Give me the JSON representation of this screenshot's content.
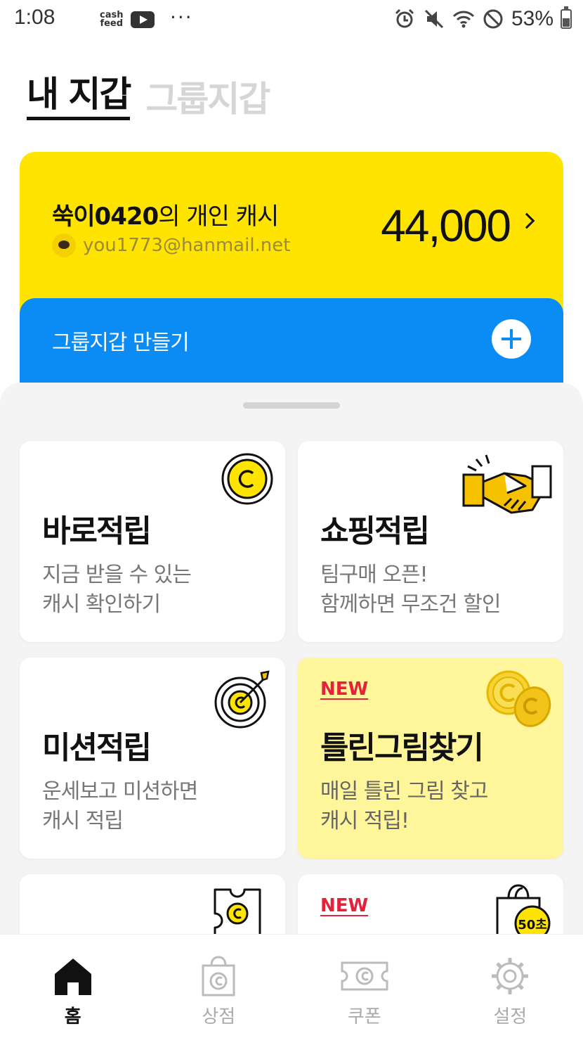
{
  "status_bar": {
    "time": "1:08",
    "cashfeed_line1": "cash",
    "cashfeed_line2": "feed",
    "more": "···",
    "battery": "53%",
    "icons": [
      "alarm-icon",
      "mute-icon",
      "wifi-icon",
      "do-not-disturb-icon",
      "battery-icon"
    ]
  },
  "tabs": [
    {
      "label": "내 지갑",
      "active": true
    },
    {
      "label": "그룹지갑",
      "active": false
    }
  ],
  "cash_card": {
    "owner_name": "쑥이0420",
    "owner_suffix": "의 개인 캐시",
    "email": "you1773@hanmail.net",
    "amount": "44,000",
    "color": "#ffe400"
  },
  "group_card": {
    "label": "그룹지갑 만들기",
    "color": "#0a8cf4"
  },
  "cards": [
    {
      "title": "바로적립",
      "desc_line1": "지금 받을 수 있는",
      "desc_line2": "캐시 확인하기",
      "icon": "coin-icon"
    },
    {
      "title": "쇼핑적립",
      "desc_line1": "팀구매 오픈!",
      "desc_line2": "함께하면 무조건 할인",
      "icon": "handshake-icon"
    },
    {
      "title": "미션적립",
      "desc_line1": "운세보고 미션하면",
      "desc_line2": "캐시 적립",
      "icon": "target-icon"
    },
    {
      "badge": "NEW",
      "title": "틀린그림찾기",
      "desc_line1": "매일 틀린 그림 찾고",
      "desc_line2": "캐시 적립!",
      "icon": "coins-icon"
    },
    {
      "title": "",
      "icon": "puzzle-coin-icon"
    },
    {
      "badge": "NEW",
      "title": "",
      "icon": "shopping-bag-timer-icon",
      "timer": "50초"
    }
  ],
  "bottom_nav": [
    {
      "label": "홈",
      "icon": "home-icon",
      "active": true
    },
    {
      "label": "상점",
      "icon": "shop-bag-icon",
      "active": false
    },
    {
      "label": "쿠폰",
      "icon": "coupon-icon",
      "active": false
    },
    {
      "label": "설정",
      "icon": "settings-gear-icon",
      "active": false
    }
  ]
}
